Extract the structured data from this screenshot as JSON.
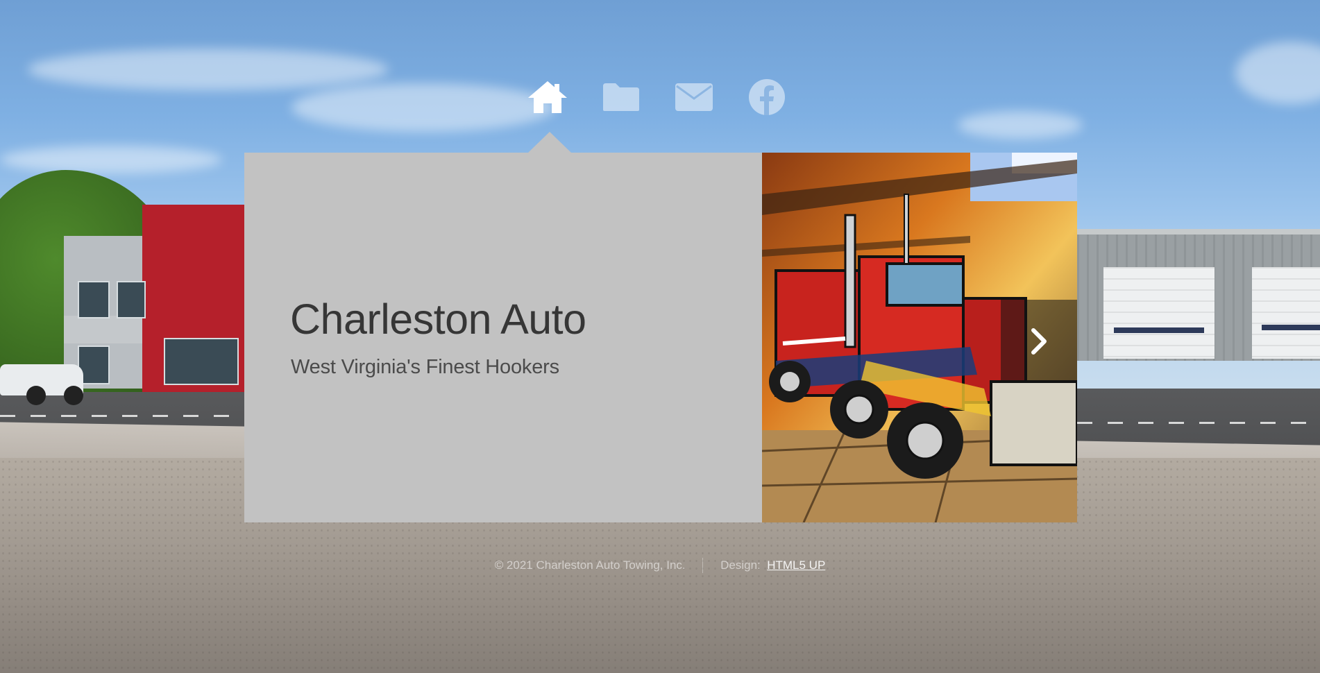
{
  "nav": {
    "items": [
      {
        "icon": "home-icon",
        "active": true
      },
      {
        "icon": "folder-icon",
        "active": false
      },
      {
        "icon": "envelope-icon",
        "active": false
      },
      {
        "icon": "facebook-icon",
        "active": false
      }
    ],
    "active_color": "#ffffff",
    "inactive_color": "rgba(255,255,255,0.5)"
  },
  "hero": {
    "title": "Charleston Auto",
    "subtitle": "West Virginia's Finest Hookers",
    "panel_color": "#c2c2c2",
    "next_icon": "chevron-right-icon"
  },
  "footer": {
    "copyright": "© 2021 Charleston Auto Towing, Inc.",
    "design_label": "Design:",
    "design_link": "HTML5 UP"
  }
}
